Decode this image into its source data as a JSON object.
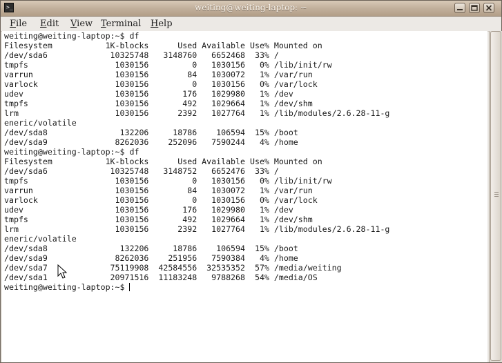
{
  "window": {
    "title": "weiting@weiting-laptop: ~",
    "controls": {
      "minimize_icon": "minimize-icon",
      "maximize_icon": "maximize-icon",
      "close_icon": "close-icon"
    }
  },
  "menubar": {
    "items": [
      "File",
      "Edit",
      "View",
      "Terminal",
      "Help"
    ]
  },
  "terminal": {
    "lines": [
      "weiting@weiting-laptop:~$ df",
      "Filesystem           1K-blocks      Used Available Use% Mounted on",
      "/dev/sda6             10325748   3148760   6652468  33% /",
      "tmpfs                  1030156         0   1030156   0% /lib/init/rw",
      "varrun                 1030156        84   1030072   1% /var/run",
      "varlock                1030156         0   1030156   0% /var/lock",
      "udev                   1030156       176   1029980   1% /dev",
      "tmpfs                  1030156       492   1029664   1% /dev/shm",
      "lrm                    1030156      2392   1027764   1% /lib/modules/2.6.28-11-g",
      "eneric/volatile",
      "/dev/sda8               132206     18786    106594  15% /boot",
      "/dev/sda9              8262036    252096   7590244   4% /home",
      "weiting@weiting-laptop:~$ df",
      "Filesystem           1K-blocks      Used Available Use% Mounted on",
      "/dev/sda6             10325748   3148752   6652476  33% /",
      "tmpfs                  1030156         0   1030156   0% /lib/init/rw",
      "varrun                 1030156        84   1030072   1% /var/run",
      "varlock                1030156         0   1030156   0% /var/lock",
      "udev                   1030156       176   1029980   1% /dev",
      "tmpfs                  1030156       492   1029664   1% /dev/shm",
      "lrm                    1030156      2392   1027764   1% /lib/modules/2.6.28-11-g",
      "eneric/volatile",
      "/dev/sda8               132206     18786    106594  15% /boot",
      "/dev/sda9              8262036    251956   7590384   4% /home",
      "/dev/sda7             75119908  42584556  32535352  57% /media/weiting",
      "/dev/sda1             20971516  11183248   9788268  54% /media/OS"
    ],
    "prompt": "weiting@weiting-laptop:~$ "
  }
}
